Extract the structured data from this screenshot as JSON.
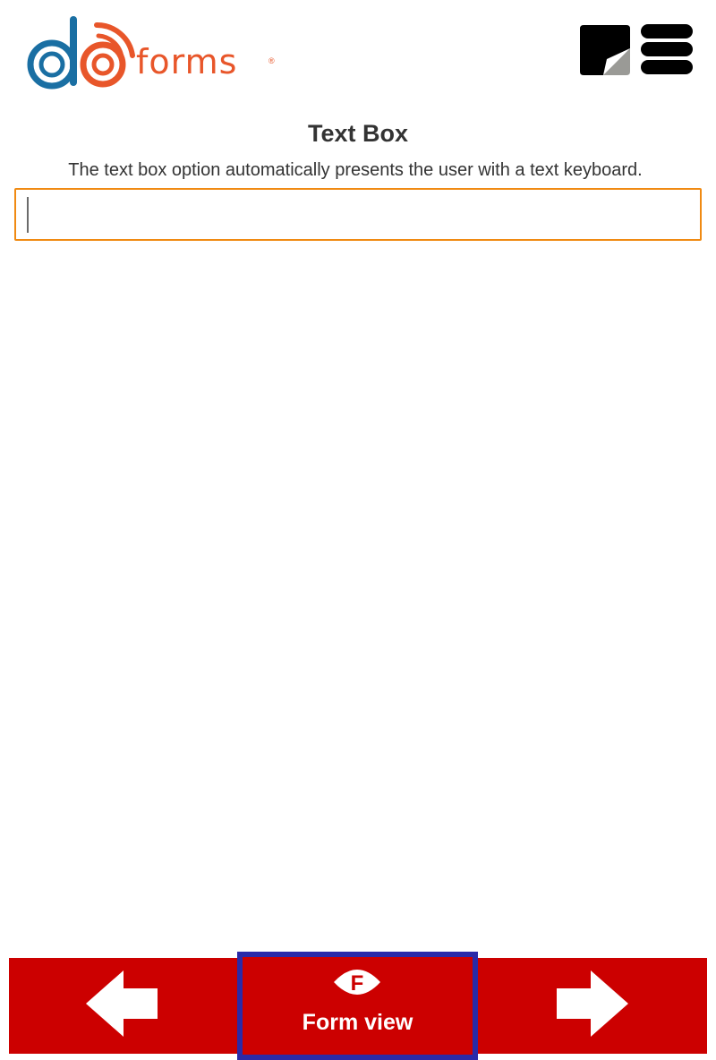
{
  "header": {
    "logo": {
      "wordmark": "forms",
      "registered_mark": "®",
      "brand_blue": "#1a6fa3",
      "brand_orange": "#e8562a"
    },
    "notes_icon": "sticky-note-icon",
    "menu_icon": "hamburger-menu-icon"
  },
  "field": {
    "title": "Text Box",
    "hint": "The text box option automatically presents the user with a text keyboard.",
    "value": "",
    "placeholder": "",
    "border_color": "#f08a12"
  },
  "footer": {
    "prev_icon": "arrow-left-icon",
    "next_icon": "arrow-right-icon",
    "form_view": {
      "icon_letter": "F",
      "label": "Form view"
    },
    "bar_color": "#cc0000",
    "highlight_color": "#2a2aa8"
  }
}
